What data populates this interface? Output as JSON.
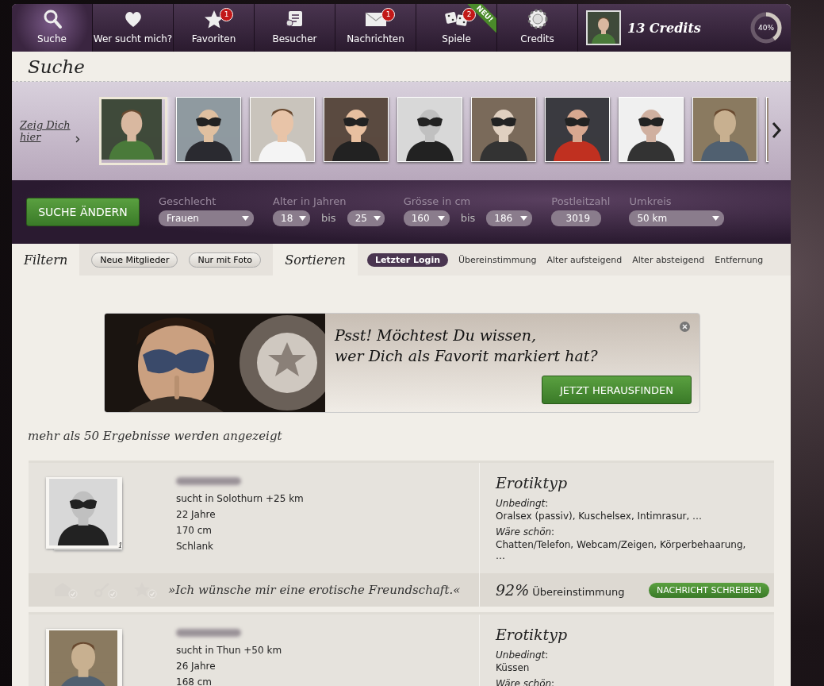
{
  "nav": {
    "items": [
      {
        "label": "Suche",
        "selected": true
      },
      {
        "label": "Wer sucht mich?",
        "selected": false
      },
      {
        "label": "Favoriten",
        "badge": "1",
        "selected": false
      },
      {
        "label": "Besucher",
        "selected": false
      },
      {
        "label": "Nachrichten",
        "badge": "1",
        "selected": false
      },
      {
        "label": "Spiele",
        "badge": "2",
        "ribbon": "NEU!",
        "selected": false
      },
      {
        "label": "Credits",
        "selected": false
      }
    ],
    "account": {
      "credits": "13 Credits",
      "progress": {
        "level": 0.4,
        "label": "40%"
      }
    }
  },
  "page_title": "Suche",
  "carousel": {
    "link": "Zeig Dich hier",
    "photos": [
      {
        "kind": "picture",
        "highlighted": true
      },
      {
        "kind": "picture",
        "highlighted": false
      },
      {
        "kind": "picture",
        "highlighted": false
      },
      {
        "kind": "picture",
        "highlighted": false
      },
      {
        "kind": "picture",
        "highlighted": false
      },
      {
        "kind": "picture",
        "highlighted": false
      },
      {
        "kind": "picture",
        "highlighted": false
      },
      {
        "kind": "picture",
        "highlighted": false
      },
      {
        "kind": "picture",
        "highlighted": false
      },
      {
        "kind": "picture",
        "highlighted": false
      }
    ]
  },
  "search_form": {
    "button": "SUCHE ÄNDERN",
    "fields": [
      {
        "kind": "select",
        "label": "Geschlecht",
        "value": "Frauen"
      },
      {
        "kind": "range",
        "label": "Alter in Jahren",
        "from": "18",
        "separator": "bis",
        "to": "25"
      },
      {
        "kind": "range",
        "label": "Grösse in cm",
        "from": "160",
        "separator": "bis",
        "to": "186"
      },
      {
        "kind": "input",
        "label": "Postleitzahl",
        "value": "3019"
      },
      {
        "kind": "select",
        "label": "Umkreis",
        "value": "50 km"
      }
    ]
  },
  "filter_bar": {
    "filter_label": "Filtern",
    "filters": [
      {
        "label": "Neue Mitglieder",
        "selected": false
      },
      {
        "label": "Nur mit Foto",
        "selected": false
      }
    ],
    "sort_label": "Sortieren",
    "sort_options": [
      {
        "label": "Letzter Login",
        "selected": true
      },
      {
        "label": "Übereinstimmung",
        "selected": false
      },
      {
        "label": "Alter aufsteigend",
        "selected": false
      },
      {
        "label": "Alter absteigend",
        "selected": false
      },
      {
        "label": "Entfernung",
        "selected": false
      }
    ]
  },
  "promo": {
    "headline_lines": [
      "Psst! Möchtest Du wissen,",
      "wer Dich als Favorit markiert hat?"
    ],
    "button": "JETZT HERAUSFINDEN"
  },
  "results_summary": "mehr als 50 Ergebnisse werden angezeigt",
  "results": [
    {
      "details": [
        "sucht in Solothurn +25 km",
        "22 Jahre",
        "170 cm",
        "Schlank"
      ],
      "photo_count": "1",
      "section_title": "Erotiktyp",
      "must_label": "*Unbedingt*:",
      "must": "Oralsex (passiv), Kuschelsex, Intimrasur, …",
      "nice_label": "*Wäre schön*:",
      "nice": "Chatten/Telefon, Webcam/Zeigen, Körperbehaarung, …",
      "quote": "»Ich wünsche mir eine erotische Freundschaft.«",
      "match": "92%",
      "match_label": "Übereinstimmung",
      "button": "NACHRICHT SCHREIBEN"
    },
    {
      "details": [
        "sucht in Thun +50 km",
        "26 Jahre",
        "168 cm"
      ],
      "section_title": "Erotiktyp",
      "must_label": "*Unbedingt*:",
      "must": "Küssen",
      "nice_label": "*Wäre schön*:"
    }
  ]
}
